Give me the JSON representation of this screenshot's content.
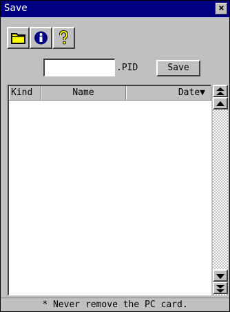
{
  "window": {
    "title": "Save",
    "close_symbol": "×"
  },
  "toolbar": {
    "buttons": [
      {
        "icon": "folder-icon",
        "color": "#ffff00"
      },
      {
        "icon": "info-icon",
        "color": "#000080"
      },
      {
        "icon": "help-icon",
        "color": "#ffff00"
      }
    ]
  },
  "file": {
    "name_value": "",
    "name_placeholder": "",
    "extension": ".PID",
    "save_label": "Save"
  },
  "list": {
    "columns": [
      "Kind",
      "Name",
      "Date"
    ],
    "sort_indicator": "▼",
    "rows": []
  },
  "scrollbar": {
    "icons": [
      "scroll-top-icon",
      "scroll-up-icon",
      "scroll-down-icon",
      "scroll-bottom-icon"
    ]
  },
  "status": {
    "message": "* Never remove the PC card."
  }
}
